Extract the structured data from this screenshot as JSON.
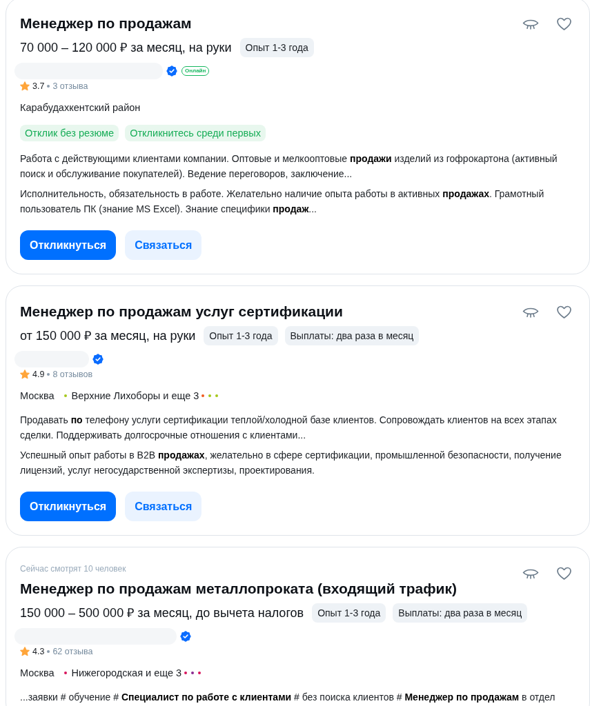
{
  "vacancies": [
    {
      "title": "Менеджер по продажам",
      "favorite": false,
      "salary": "70 000 – 120 000 ₽ за месяц, на руки",
      "chips": [
        "Опыт 1-3 года"
      ],
      "company": {
        "verified": true,
        "online": true,
        "online_label": "Онлайн"
      },
      "rating": {
        "score": "3.7",
        "reviews": "3 отзыва"
      },
      "location": {
        "city": "Карабудахкентский район"
      },
      "tags": [
        "Отклик без резюме",
        "Откликнитесь среди первых"
      ],
      "descriptions": [
        "Работа с действующими клиентами компании. Оптовые и мелкооптовые **продажи** изделий из гофрокартона (активный поиск и обслуживание покупателей). Ведение переговоров, заключение...",
        "Исполнительность, обязательность в работе. Желательно наличие опыта работы в активных **продажах**. Грамотный пользователь ПК (знание MS Excel). Знание специфики **продаж**..."
      ],
      "buttons": [
        {
          "label": "Откликнуться",
          "kind": "primary"
        },
        {
          "label": "Связаться",
          "kind": "secondary"
        }
      ]
    },
    {
      "title": "Менеджер по продажам услуг сертификации",
      "favorite": false,
      "salary": "от 150 000 ₽ за месяц, на руки",
      "chips": [
        "Опыт 1-3 года",
        "Выплаты: два раза в месяц"
      ],
      "company": {
        "verified": true,
        "online": false
      },
      "rating": {
        "score": "4.9",
        "reviews": "8 отзывов"
      },
      "location": {
        "city": "Москва",
        "station": {
          "name": "Верхние Лихоборы и еще 3",
          "color": "#a6c81c"
        },
        "other_lines": [
          {
            "color": "#f05a1e"
          },
          {
            "color": "#a6c81c"
          },
          {
            "color": "#a6c81c"
          }
        ]
      },
      "descriptions": [
        "Продавать **по** телефону услуги сертификации теплой/холодной базе клиентов. Сопровождать клиентов на всех этапах сделки. Поддерживать долгосрочные отношения с клиентами...",
        "Успешный опыт работы в B2B **продажах**, желательно в сфере сертификации, промышленной безопасности, получение лицензий, услуг негосударственной экспертизы, проектирования."
      ],
      "buttons": [
        {
          "label": "Откликнуться",
          "kind": "primary"
        },
        {
          "label": "Связаться",
          "kind": "secondary"
        }
      ]
    },
    {
      "viewers": "Сейчас смотрят 10 человек",
      "title": "Менеджер по продажам металлопроката (входящий трафик)",
      "favorite": false,
      "salary": "150 000 – 500 000 ₽ за месяц, до вычета налогов",
      "chips": [
        "Опыт 1-3 года",
        "Выплаты: два раза в месяц"
      ],
      "company": {
        "verified": true,
        "online": false
      },
      "rating": {
        "score": "4.3",
        "reviews": "62 отзыва"
      },
      "location": {
        "city": "Москва",
        "station": {
          "name": "Нижегородская и еще 3",
          "color": "#d8155c"
        },
        "other_lines": [
          {
            "color": "#d8155c"
          },
          {
            "color": "#8b2a90"
          },
          {
            "color": "#d8155c"
          }
        ]
      },
      "descriptions": [
        "...заявки # обучение # **Специалист по работе с клиентами** # без поиска клиентов # **Менеджер по продажам** в отдел"
      ]
    }
  ]
}
